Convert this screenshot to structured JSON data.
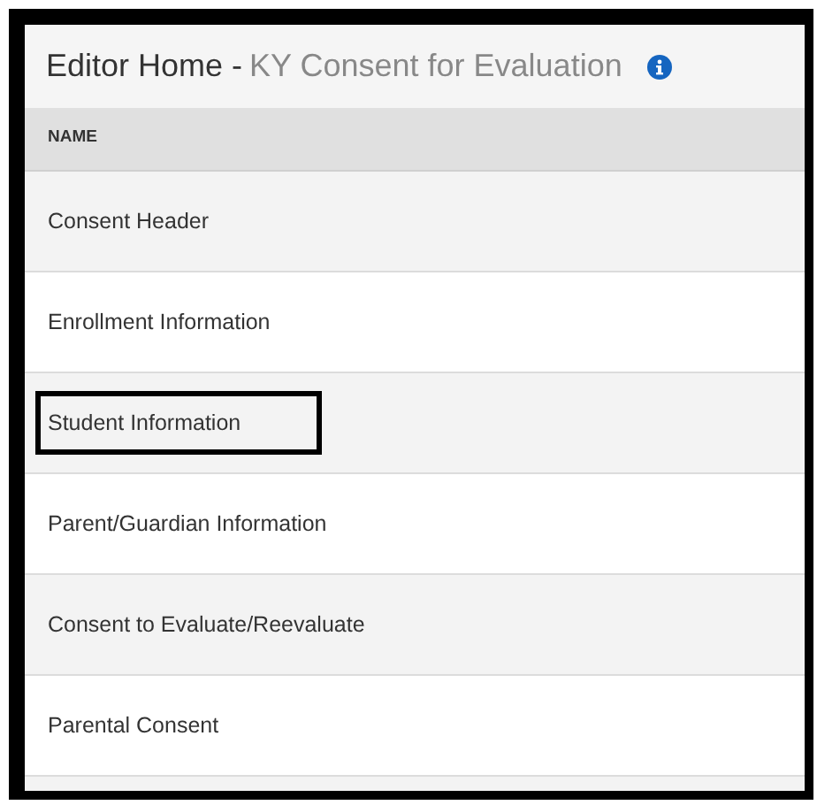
{
  "header": {
    "title": "Editor Home -",
    "subtitle": "KY Consent for Evaluation"
  },
  "table": {
    "columns": [
      "NAME"
    ],
    "rows": [
      {
        "name": "Consent Header",
        "outlined": false
      },
      {
        "name": "Enrollment Information",
        "outlined": false
      },
      {
        "name": "Student Information",
        "outlined": true
      },
      {
        "name": "Parent/Guardian Information",
        "outlined": false
      },
      {
        "name": "Consent to Evaluate/Reevaluate",
        "outlined": false
      },
      {
        "name": "Parental Consent",
        "outlined": false
      }
    ]
  }
}
